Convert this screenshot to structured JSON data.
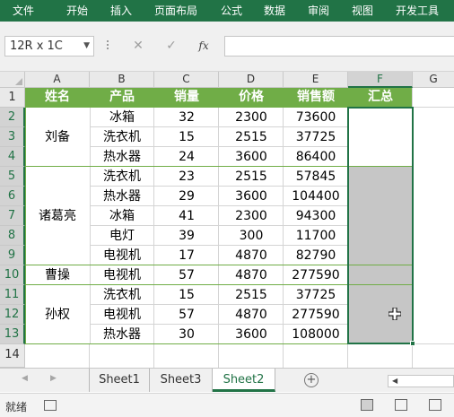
{
  "ribbon": {
    "tabs": [
      "文件",
      "开始",
      "插入",
      "页面布局",
      "公式",
      "数据",
      "审阅",
      "视图",
      "开发工具"
    ]
  },
  "formula_bar": {
    "name_box": "12R x 1C",
    "fx_label": "fx",
    "value": ""
  },
  "columns": [
    "A",
    "B",
    "C",
    "D",
    "E",
    "F",
    "G"
  ],
  "rows": [
    "1",
    "2",
    "3",
    "4",
    "5",
    "6",
    "7",
    "8",
    "9",
    "10",
    "11",
    "12",
    "13",
    "14"
  ],
  "table": {
    "headers": [
      "姓名",
      "产品",
      "销量",
      "价格",
      "销售额",
      "汇总"
    ],
    "names": [
      "刘备",
      "诸葛亮",
      "曹操",
      "孙权"
    ],
    "records": [
      [
        "冰箱",
        "32",
        "2300",
        "73600"
      ],
      [
        "洗衣机",
        "15",
        "2515",
        "37725"
      ],
      [
        "热水器",
        "24",
        "3600",
        "86400"
      ],
      [
        "洗衣机",
        "23",
        "2515",
        "57845"
      ],
      [
        "热水器",
        "29",
        "3600",
        "104400"
      ],
      [
        "冰箱",
        "41",
        "2300",
        "94300"
      ],
      [
        "电灯",
        "39",
        "300",
        "11700"
      ],
      [
        "电视机",
        "17",
        "4870",
        "82790"
      ],
      [
        "电视机",
        "57",
        "4870",
        "277590"
      ],
      [
        "洗衣机",
        "15",
        "2515",
        "37725"
      ],
      [
        "电视机",
        "57",
        "4870",
        "277590"
      ],
      [
        "热水器",
        "30",
        "3600",
        "108000"
      ]
    ]
  },
  "sheets": [
    "Sheet1",
    "Sheet3",
    "Sheet2"
  ],
  "active_sheet": "Sheet2",
  "status": {
    "text": "就绪"
  },
  "colors": {
    "accent": "#217346",
    "header_fill": "#70ad47",
    "selection_fill": "#c6c6c6"
  }
}
